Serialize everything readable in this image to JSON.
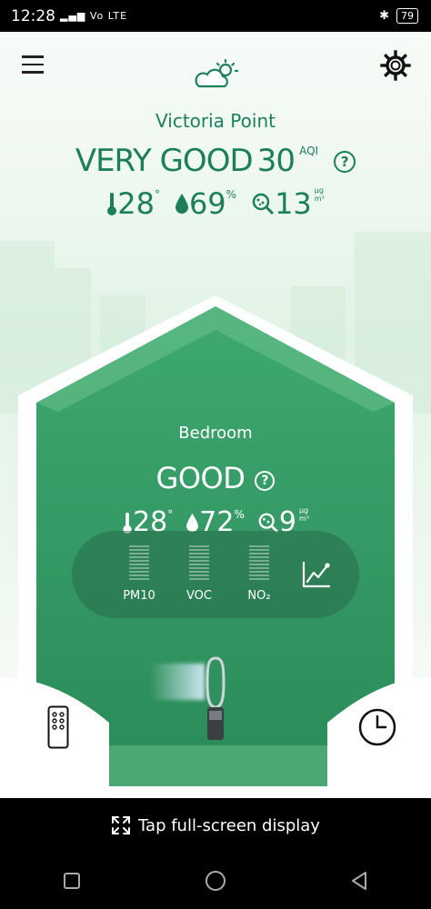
{
  "status_bar": {
    "time": "12:28",
    "network": "Vo LTE",
    "battery": "79"
  },
  "header": {
    "location": "Victoria Point"
  },
  "outdoor": {
    "quality": "VERY GOOD",
    "aqi_value": "30",
    "aqi_label": "AQI",
    "help": "?",
    "temperature": "28",
    "temperature_unit": "°",
    "humidity": "69",
    "humidity_unit": "%",
    "pm": "13",
    "pm_unit_top": "μg",
    "pm_unit_bottom": "m³"
  },
  "room": {
    "name": "Bedroom",
    "quality": "GOOD",
    "help": "?",
    "temperature": "28",
    "temperature_unit": "°",
    "humidity": "72",
    "humidity_unit": "%",
    "pm": "9",
    "pm_unit_top": "μg",
    "pm_unit_bottom": "m³",
    "pollutants": [
      {
        "label": "PM10"
      },
      {
        "label": "VOC"
      },
      {
        "label": "NO₂"
      }
    ]
  },
  "footer": {
    "fullscreen_label": "Tap full-screen display"
  },
  "colors": {
    "accent": "#1c7f5a",
    "house_green": "#2f9a63"
  }
}
